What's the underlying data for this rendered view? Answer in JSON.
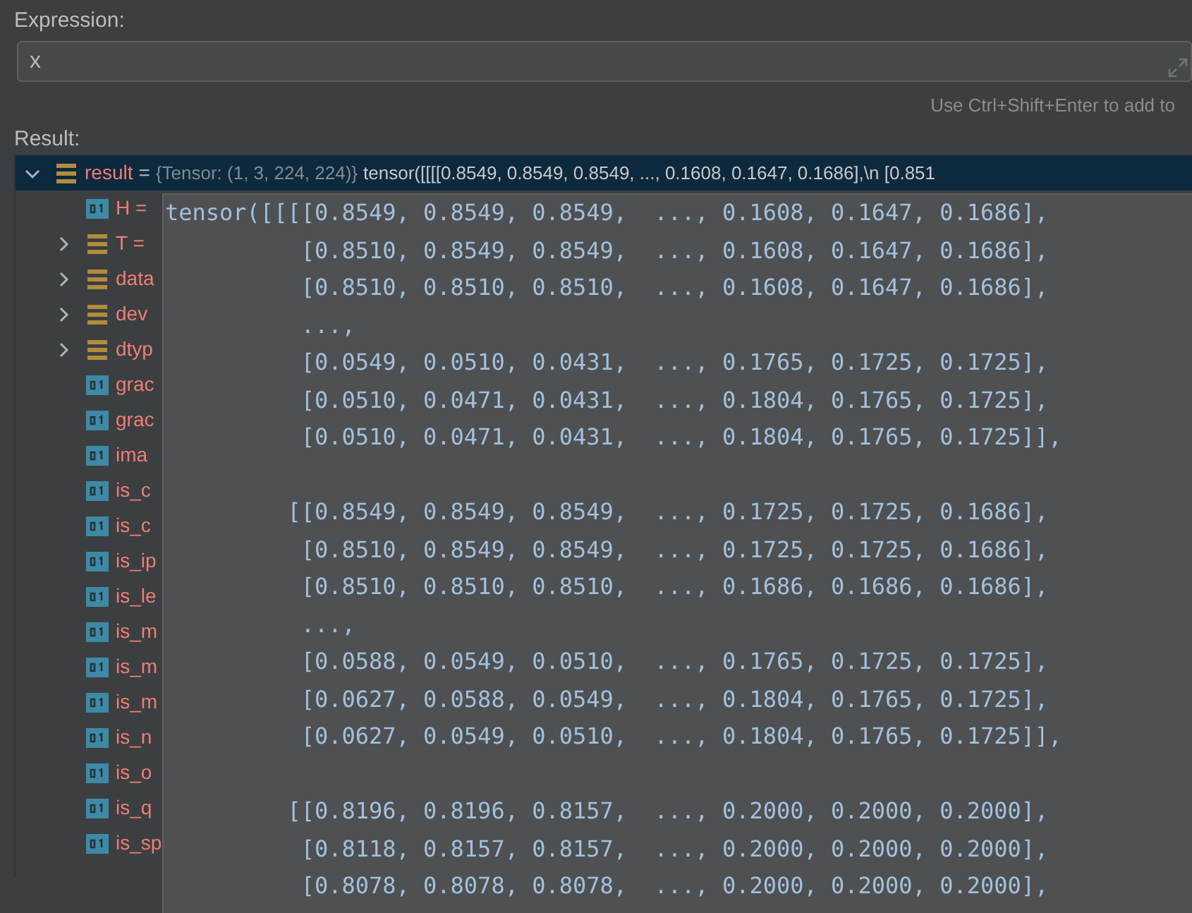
{
  "expression": {
    "label": "Expression:",
    "value": "x",
    "hint": "Use Ctrl+Shift+Enter to add to"
  },
  "result": {
    "label": "Result:",
    "tree": [
      {
        "name": "result",
        "kind": "list",
        "expanded": true,
        "selected": true,
        "separator": "=",
        "type": "{Tensor: (1, 3, 224, 224)}",
        "value": "tensor([[[[0.8549, 0.8549, 0.8549,  ..., 0.1608, 0.1647, 0.1686],\\n        [0.851",
        "children": [
          {
            "name": "H =",
            "kind": "value"
          },
          {
            "name": "T =",
            "kind": "list",
            "expanded": false
          },
          {
            "name": "data",
            "kind": "list",
            "expanded": false
          },
          {
            "name": "dev",
            "kind": "list",
            "expanded": false
          },
          {
            "name": "dtyp",
            "kind": "list",
            "expanded": false
          },
          {
            "name": "grac",
            "kind": "value"
          },
          {
            "name": "grac",
            "kind": "value"
          },
          {
            "name": "ima",
            "kind": "value"
          },
          {
            "name": "is_c",
            "kind": "value"
          },
          {
            "name": "is_c",
            "kind": "value"
          },
          {
            "name": "is_ip",
            "kind": "value"
          },
          {
            "name": "is_le",
            "kind": "value"
          },
          {
            "name": "is_m",
            "kind": "value"
          },
          {
            "name": "is_m",
            "kind": "value"
          },
          {
            "name": "is_m",
            "kind": "value"
          },
          {
            "name": "is_n",
            "kind": "value"
          },
          {
            "name": "is_o",
            "kind": "value"
          },
          {
            "name": "is_q",
            "kind": "value"
          },
          {
            "name": "is_sp",
            "kind": "value"
          }
        ]
      }
    ]
  },
  "tooltip": {
    "blocks": [
      [
        "tensor([[[[0.8549, 0.8549, 0.8549,  ..., 0.1608, 0.1647, 0.1686],",
        "          [0.8510, 0.8549, 0.8549,  ..., 0.1608, 0.1647, 0.1686],",
        "          [0.8510, 0.8510, 0.8510,  ..., 0.1608, 0.1647, 0.1686],",
        "          ...,",
        "          [0.0549, 0.0510, 0.0431,  ..., 0.1765, 0.1725, 0.1725],",
        "          [0.0510, 0.0471, 0.0431,  ..., 0.1804, 0.1765, 0.1725],",
        "          [0.0510, 0.0471, 0.0431,  ..., 0.1804, 0.1765, 0.1725]],"
      ],
      [
        "         [[0.8549, 0.8549, 0.8549,  ..., 0.1725, 0.1725, 0.1686],",
        "          [0.8510, 0.8549, 0.8549,  ..., 0.1725, 0.1725, 0.1686],",
        "          [0.8510, 0.8510, 0.8510,  ..., 0.1686, 0.1686, 0.1686],",
        "          ...,",
        "          [0.0588, 0.0549, 0.0510,  ..., 0.1765, 0.1725, 0.1725],",
        "          [0.0627, 0.0588, 0.0549,  ..., 0.1804, 0.1765, 0.1725],",
        "          [0.0627, 0.0549, 0.0510,  ..., 0.1804, 0.1765, 0.1725]],"
      ],
      [
        "         [[0.8196, 0.8196, 0.8157,  ..., 0.2000, 0.2000, 0.2000],",
        "          [0.8118, 0.8157, 0.8157,  ..., 0.2000, 0.2000, 0.2000],",
        "          [0.8078, 0.8078, 0.8078,  ..., 0.2000, 0.2000, 0.2000],"
      ]
    ]
  }
}
